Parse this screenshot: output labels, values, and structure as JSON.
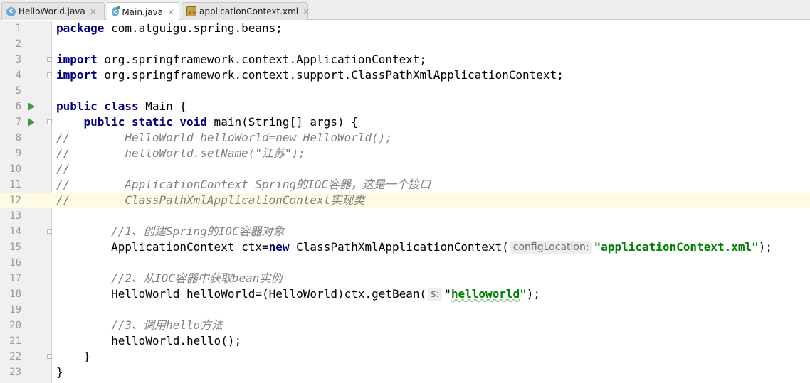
{
  "tabs": [
    {
      "label": "HelloWorld.java",
      "icon": "java-class-icon",
      "active": false
    },
    {
      "label": "Main.java",
      "icon": "java-main-class-icon",
      "active": true
    },
    {
      "label": "applicationContext.xml",
      "icon": "xml-file-icon",
      "active": false
    }
  ],
  "close_glyph": "×",
  "lines": [
    {
      "n": "1",
      "tokens": [
        {
          "t": "package",
          "s": "kw"
        },
        {
          "t": " com.atguigu.spring.beans;"
        }
      ]
    },
    {
      "n": "2",
      "tokens": []
    },
    {
      "n": "3",
      "fold": true,
      "tokens": [
        {
          "t": "import",
          "s": "kw"
        },
        {
          "t": " org.springframework.context.ApplicationContext;"
        }
      ]
    },
    {
      "n": "4",
      "fold": true,
      "tokens": [
        {
          "t": "import",
          "s": "kw"
        },
        {
          "t": " org.springframework.context.support.ClassPathXmlApplicationContext;"
        }
      ]
    },
    {
      "n": "5",
      "tokens": []
    },
    {
      "n": "6",
      "run": true,
      "tokens": [
        {
          "t": "public class",
          "s": "kw"
        },
        {
          "t": " Main {"
        }
      ]
    },
    {
      "n": "7",
      "run": true,
      "fold": true,
      "tokens": [
        {
          "t": "    "
        },
        {
          "t": "public static void",
          "s": "kw"
        },
        {
          "t": " main(String[] args) {"
        }
      ]
    },
    {
      "n": "8",
      "tokens": [
        {
          "t": "//        HelloWorld helloWorld=new HelloWorld();",
          "s": "cm"
        }
      ]
    },
    {
      "n": "9",
      "tokens": [
        {
          "t": "//        helloWorld.setName(\"江苏\");",
          "s": "cm"
        }
      ]
    },
    {
      "n": "10",
      "tokens": [
        {
          "t": "//",
          "s": "cm"
        }
      ]
    },
    {
      "n": "11",
      "tokens": [
        {
          "t": "//        ApplicationContext Spring的IOC容器，这是一个接口",
          "s": "cm"
        }
      ]
    },
    {
      "n": "12",
      "current": true,
      "tokens": [
        {
          "t": "//        ClassPathXmlApplicationContext实现类",
          "s": "cm"
        }
      ]
    },
    {
      "n": "13",
      "tokens": []
    },
    {
      "n": "14",
      "fold": true,
      "tokens": [
        {
          "t": "        "
        },
        {
          "t": "//1、创建Spring的IOC容器对象",
          "s": "cm"
        }
      ]
    },
    {
      "n": "15",
      "tokens": [
        {
          "t": "        ApplicationContext ctx="
        },
        {
          "t": "new",
          "s": "kw"
        },
        {
          "t": " ClassPathXmlApplicationContext("
        },
        {
          "t": "configLocation:",
          "s": "hint"
        },
        {
          "t": "\"applicationContext.xml\"",
          "s": "str"
        },
        {
          "t": ");"
        }
      ]
    },
    {
      "n": "16",
      "tokens": []
    },
    {
      "n": "17",
      "tokens": [
        {
          "t": "        "
        },
        {
          "t": "//2、从IOC容器中获取bean实例",
          "s": "cm"
        }
      ]
    },
    {
      "n": "18",
      "tokens": [
        {
          "t": "        HelloWorld helloWorld=(HelloWorld)ctx.getBean("
        },
        {
          "t": "s:",
          "s": "hint"
        },
        {
          "t": "\""
        },
        {
          "t": "helloworld",
          "s": "str typo"
        },
        {
          "t": "\"",
          "s": "str"
        },
        {
          "t": ");"
        }
      ]
    },
    {
      "n": "19",
      "tokens": []
    },
    {
      "n": "20",
      "tokens": [
        {
          "t": "        "
        },
        {
          "t": "//3、调用hello方法",
          "s": "cm"
        }
      ]
    },
    {
      "n": "21",
      "tokens": [
        {
          "t": "        helloWorld.hello();"
        }
      ]
    },
    {
      "n": "22",
      "fold": true,
      "tokens": [
        {
          "t": "    }"
        }
      ]
    },
    {
      "n": "23",
      "tokens": [
        {
          "t": "}"
        }
      ]
    }
  ]
}
